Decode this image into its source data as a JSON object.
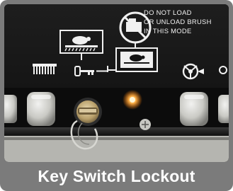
{
  "caption": "Key Switch Lockout",
  "panel": {
    "warning_lines": [
      "DO NOT LOAD",
      "OR UNLOAD BRUSH",
      "IN THIS MODE"
    ]
  },
  "indicator": {
    "color": "#ff8a1e",
    "state": "on"
  },
  "icons": [
    "brush-icon",
    "vehicle-brush-icon",
    "key-icon",
    "no-loading-icon",
    "fan-icon"
  ]
}
